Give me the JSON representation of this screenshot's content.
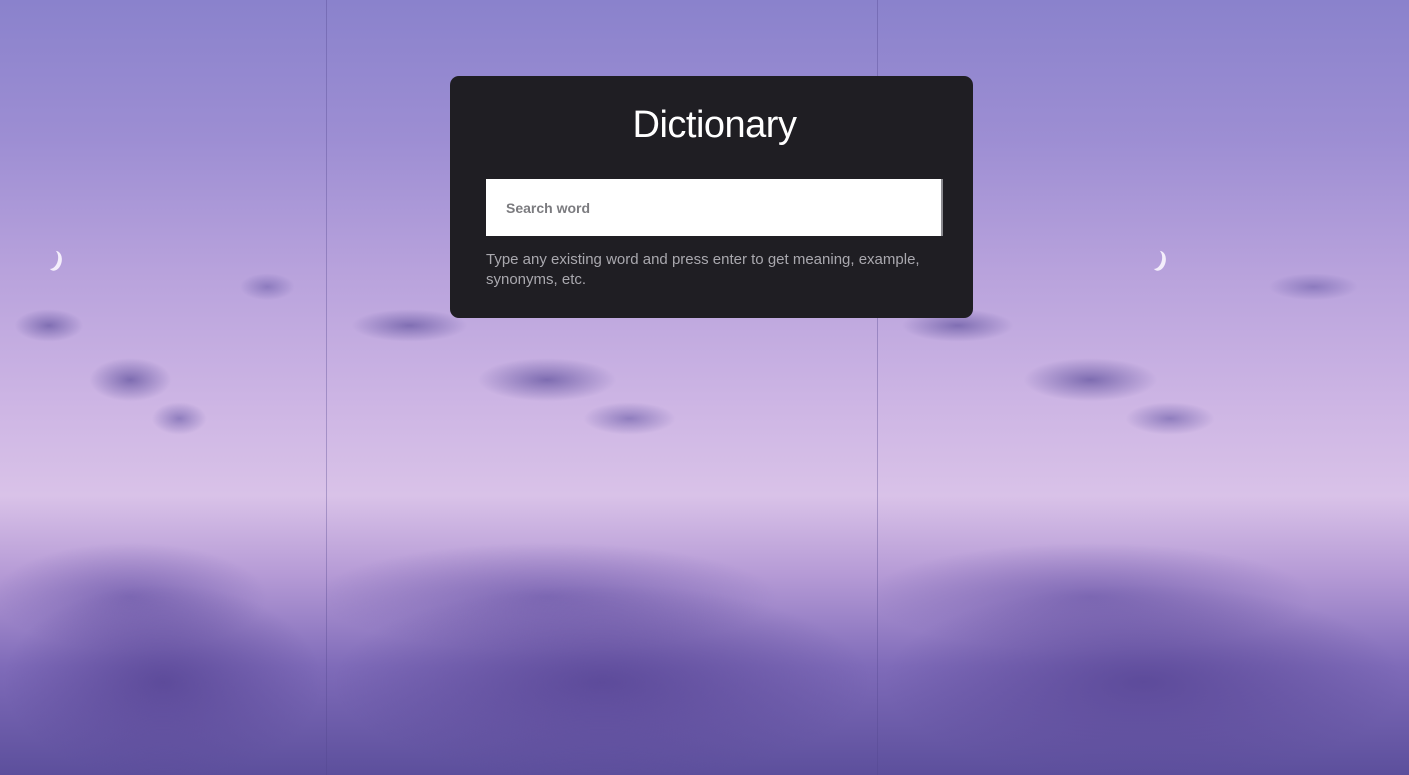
{
  "app": {
    "title": "Dictionary"
  },
  "search": {
    "placeholder": "Search word",
    "value": ""
  },
  "hint": {
    "text": "Type any existing word and press enter to get meaning, example, synonyms, etc."
  },
  "colors": {
    "card_background": "#1f1e23",
    "title": "#ffffff",
    "hint": "#a9a8ae",
    "sky_top": "#8a82cc",
    "sky_bottom": "#5c4f9c"
  },
  "icons": {
    "moon": "crescent-moon"
  }
}
